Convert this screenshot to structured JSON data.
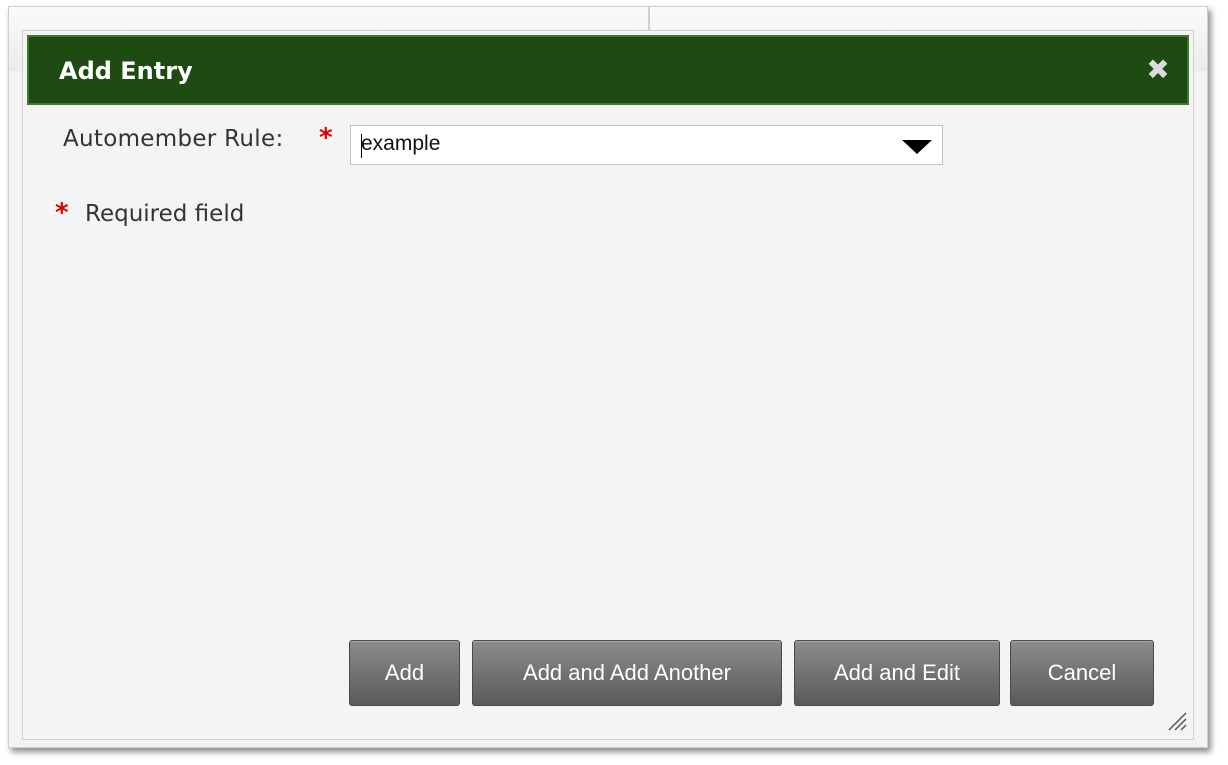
{
  "dialog": {
    "title": "Add Entry",
    "close_icon": "close-icon"
  },
  "form": {
    "field_label": "Automember Rule:",
    "required_marker": "*",
    "select_value": "example",
    "dropdown_icon": "chevron-down-icon"
  },
  "note": {
    "marker": "*",
    "text": "Required field"
  },
  "buttons": {
    "add": "Add",
    "add_another": "Add and Add Another",
    "add_edit": "Add and Edit",
    "cancel": "Cancel"
  },
  "colors": {
    "titlebar": "#1d4b12",
    "required": "#e00000",
    "button": "#6e6e6e"
  }
}
